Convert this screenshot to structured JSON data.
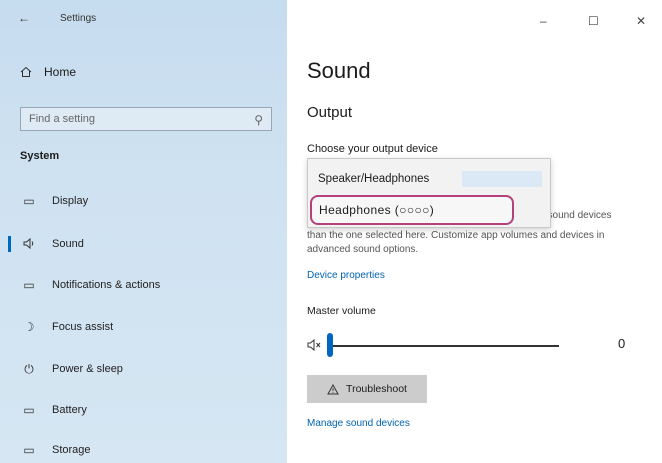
{
  "window": {
    "title": "Settings",
    "back_glyph": "←",
    "minimize_glyph": "–",
    "maximize_glyph": "☐",
    "close_glyph": "✕"
  },
  "sidebar": {
    "home_label": "Home",
    "search_placeholder": "Find a setting",
    "section_title": "System",
    "items": [
      {
        "label": "Display",
        "icon": "display-icon",
        "glyph": "▭"
      },
      {
        "label": "Sound",
        "icon": "speaker-icon",
        "glyph": "🔈",
        "active": true
      },
      {
        "label": "Notifications & actions",
        "icon": "notifications-icon",
        "glyph": "▭"
      },
      {
        "label": "Focus assist",
        "icon": "moon-icon",
        "glyph": "☽"
      },
      {
        "label": "Power & sleep",
        "icon": "power-icon",
        "glyph": "⏻"
      },
      {
        "label": "Battery",
        "icon": "battery-icon",
        "glyph": "▭"
      },
      {
        "label": "Storage",
        "icon": "storage-icon",
        "glyph": "▭"
      }
    ]
  },
  "main": {
    "title": "Sound",
    "output_heading": "Output",
    "choose_device_label": "Choose your output device",
    "dropdown_options": [
      "Speaker/Headphones",
      "Headphones (○○○○)"
    ],
    "description_tail": "t sound devices",
    "description": "than the one selected here. Customize app volumes and devices in advanced sound options.",
    "device_properties_link": "Device properties",
    "master_volume_label": "Master volume",
    "volume_value": "0",
    "volume_fraction": 0,
    "troubleshoot_label": "Troubleshoot",
    "manage_devices_link": "Manage sound devices"
  },
  "colors": {
    "accent": "#0067c0",
    "link": "#0063b1",
    "highlight_border": "#b4417b"
  }
}
